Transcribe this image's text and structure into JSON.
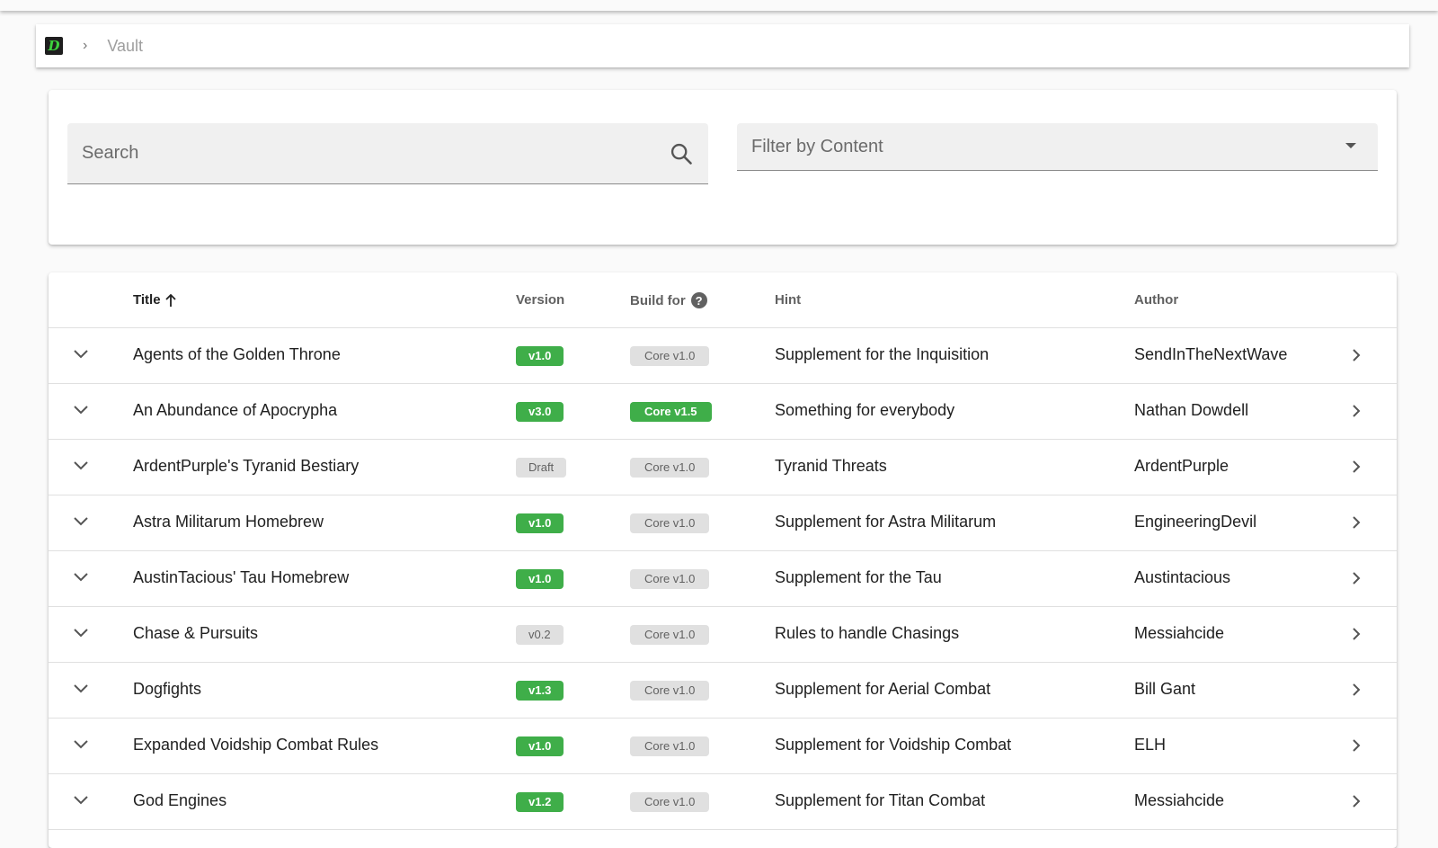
{
  "breadcrumb": {
    "logo_letter": "D",
    "separator": "›",
    "current": "Vault"
  },
  "filters": {
    "search_placeholder": "Search",
    "content_filter_label": "Filter by Content"
  },
  "table": {
    "columns": {
      "title": "Title",
      "version": "Version",
      "build_for": "Build for",
      "hint": "Hint",
      "author": "Author"
    },
    "help_symbol": "?",
    "rows": [
      {
        "title": "Agents of the Golden Throne",
        "version": "v1.0",
        "version_style": "green",
        "build": "Core v1.0",
        "build_style": "grey",
        "hint": "Supplement for the Inquisition",
        "author": "SendInTheNextWave"
      },
      {
        "title": "An Abundance of Apocrypha",
        "version": "v3.0",
        "version_style": "green",
        "build": "Core v1.5",
        "build_style": "green",
        "hint": "Something for everybody",
        "author": "Nathan Dowdell"
      },
      {
        "title": "ArdentPurple's Tyranid Bestiary",
        "version": "Draft",
        "version_style": "grey",
        "build": "Core v1.0",
        "build_style": "grey",
        "hint": "Tyranid Threats",
        "author": "ArdentPurple"
      },
      {
        "title": "Astra Militarum Homebrew",
        "version": "v1.0",
        "version_style": "green",
        "build": "Core v1.0",
        "build_style": "grey",
        "hint": "Supplement for Astra Militarum",
        "author": "EngineeringDevil"
      },
      {
        "title": "AustinTacious' Tau Homebrew",
        "version": "v1.0",
        "version_style": "green",
        "build": "Core v1.0",
        "build_style": "grey",
        "hint": "Supplement for the Tau",
        "author": "Austintacious"
      },
      {
        "title": "Chase & Pursuits",
        "version": "v0.2",
        "version_style": "grey",
        "build": "Core v1.0",
        "build_style": "grey",
        "hint": "Rules to handle Chasings",
        "author": "Messiahcide"
      },
      {
        "title": "Dogfights",
        "version": "v1.3",
        "version_style": "green",
        "build": "Core v1.0",
        "build_style": "grey",
        "hint": "Supplement for Aerial Combat",
        "author": "Bill Gant"
      },
      {
        "title": "Expanded Voidship Combat Rules",
        "version": "v1.0",
        "version_style": "green",
        "build": "Core v1.0",
        "build_style": "grey",
        "hint": "Supplement for Voidship Combat",
        "author": "ELH"
      },
      {
        "title": "God Engines",
        "version": "v1.2",
        "version_style": "green",
        "build": "Core v1.0",
        "build_style": "grey",
        "hint": "Supplement for Titan Combat",
        "author": "Messiahcide"
      }
    ]
  },
  "colors": {
    "accent_green": "#3fae49",
    "chip_grey": "#e0e0e0",
    "logo_green": "#3dd13d"
  }
}
